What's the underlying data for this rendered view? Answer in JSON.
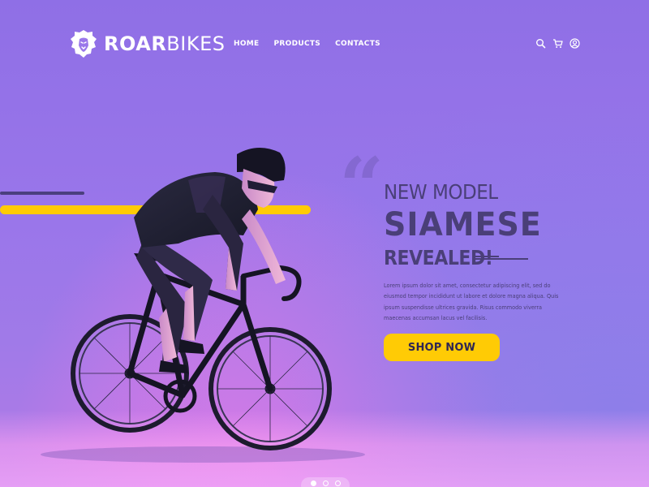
{
  "brand": {
    "name_bold": "ROAR",
    "name_light": "BIKES",
    "logo_icon": "lion-head-icon"
  },
  "nav": {
    "items": [
      {
        "label": "HOME"
      },
      {
        "label": "PRODUCTS"
      },
      {
        "label": "CONTACTS"
      }
    ]
  },
  "header_icons": [
    "search-icon",
    "cart-icon",
    "user-icon"
  ],
  "hero": {
    "quote_mark": "“",
    "line1": "NEW MODEL",
    "line2": "SIAMESE",
    "line3": "REVEALED!",
    "body": "Lorem ipsum dolor sit amet, consectetur adipiscing elit, sed do eiusmod tempor incididunt ut labore et dolore magna aliqua. Quis ipsum suspendisse ultrices gravida. Risus commodo viverra maecenas accumsan lacus vel facilisis.",
    "cta_label": "SHOP NOW"
  },
  "carousel": {
    "slide_count": 3,
    "active_slide": 1
  },
  "colors": {
    "accent_yellow": "#ffcb05",
    "text_dark": "#4a3f78",
    "background_purple": "#9a76ea",
    "floor_pink": "#f6aafa"
  }
}
